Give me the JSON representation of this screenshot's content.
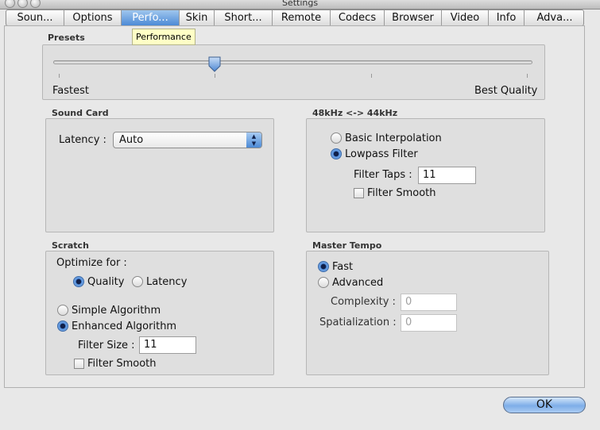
{
  "window": {
    "title": "Settings"
  },
  "tabs": [
    {
      "label": "Soun...",
      "w": 73
    },
    {
      "label": "Options",
      "w": 72
    },
    {
      "label": "Perfo...",
      "w": 73,
      "active": true
    },
    {
      "label": "Skin",
      "w": 44
    },
    {
      "label": "Short...",
      "w": 73
    },
    {
      "label": "Remote",
      "w": 73
    },
    {
      "label": "Codecs",
      "w": 68
    },
    {
      "label": "Browser",
      "w": 72
    },
    {
      "label": "Video",
      "w": 59
    },
    {
      "label": "Info",
      "w": 45
    },
    {
      "label": "Adva...",
      "w": 76
    }
  ],
  "tooltip": "Performance",
  "presets": {
    "label": "Presets",
    "left_label": "Fastest",
    "right_label": "Best Quality",
    "slider_position": 0.33
  },
  "sound_card": {
    "label": "Sound Card",
    "latency_label": "Latency :",
    "latency_value": "Auto"
  },
  "resample": {
    "label": "48kHz <-> 44kHz",
    "basic": "Basic Interpolation",
    "lowpass": "Lowpass Filter",
    "filter_taps_label": "Filter Taps :",
    "filter_taps_value": "11",
    "filter_smooth": "Filter Smooth"
  },
  "scratch": {
    "label": "Scratch",
    "optimize_label": "Optimize for :",
    "quality": "Quality",
    "latency": "Latency",
    "simple": "Simple Algorithm",
    "enhanced": "Enhanced Algorithm",
    "filter_size_label": "Filter Size :",
    "filter_size_value": "11",
    "filter_smooth": "Filter Smooth"
  },
  "master_tempo": {
    "label": "Master Tempo",
    "fast": "Fast",
    "advanced": "Advanced",
    "complexity_label": "Complexity :",
    "complexity_value": "0",
    "spatialization_label": "Spatialization :",
    "spatialization_value": "0"
  },
  "ok_label": "OK"
}
